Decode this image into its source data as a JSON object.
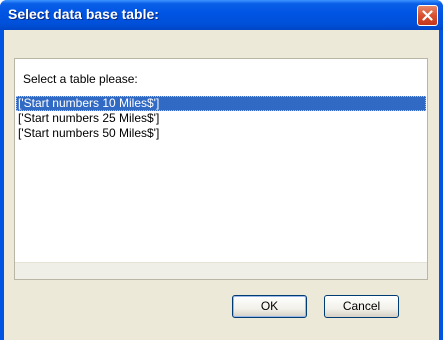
{
  "window": {
    "title": "Select data base table:"
  },
  "panel": {
    "prompt": "Select a table please:",
    "tables": [
      {
        "label": "['Start numbers 10 Miles$']",
        "selected": true
      },
      {
        "label": "['Start numbers 25 Miles$']",
        "selected": false
      },
      {
        "label": "['Start numbers 50 Miles$']",
        "selected": false
      }
    ]
  },
  "buttons": {
    "ok": "OK",
    "cancel": "Cancel"
  },
  "icons": {
    "close": "close-icon"
  },
  "colors": {
    "titlebar": "#0054e3",
    "selection": "#316ac5",
    "dialog_bg": "#ece9d8",
    "close": "#d8512f"
  }
}
